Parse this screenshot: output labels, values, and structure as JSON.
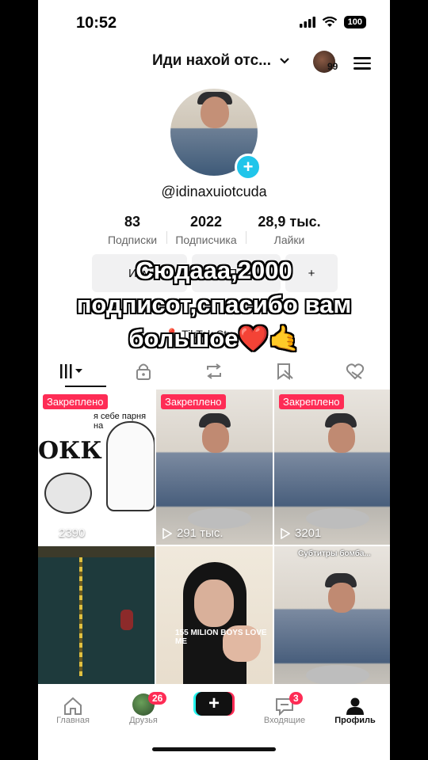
{
  "status": {
    "time": "10:52",
    "battery": "100"
  },
  "header": {
    "account_name": "Иди нахой отс...",
    "badge_count": "99"
  },
  "profile": {
    "username": "@idinaxuiotcuda",
    "stats": [
      {
        "value": "83",
        "label": "Подписки"
      },
      {
        "value": "2022",
        "label": "Подписчика"
      },
      {
        "value": "28,9 тыс.",
        "label": "Лайки"
      }
    ],
    "buttons": [
      "Изм",
      "Пе",
      "+"
    ],
    "studio": "TikTok Stu"
  },
  "overlay_text": [
    "Сюдааа,2000",
    "подписот,спасибо вам",
    "большое❤️🤙"
  ],
  "videos": [
    {
      "pinned": "Закреплено",
      "views": "2390",
      "caption": "я себе парня на",
      "big_text": "ОКК"
    },
    {
      "pinned": "Закреплено",
      "views": "291 тыс."
    },
    {
      "pinned": "Закреплено",
      "views": "3201"
    },
    {},
    {
      "caption": "155 MILION BOYS LOVE ME"
    },
    {
      "caption": "Субтитры бомба..."
    }
  ],
  "nav": {
    "home": "Главная",
    "friends": "Друзья",
    "friends_badge": "26",
    "inbox": "Входящие",
    "inbox_badge": "3",
    "profile": "Профиль"
  },
  "colors": {
    "accent": "#fe2c55",
    "cyan": "#25f4ee",
    "plus_badge": "#20c5ea"
  }
}
